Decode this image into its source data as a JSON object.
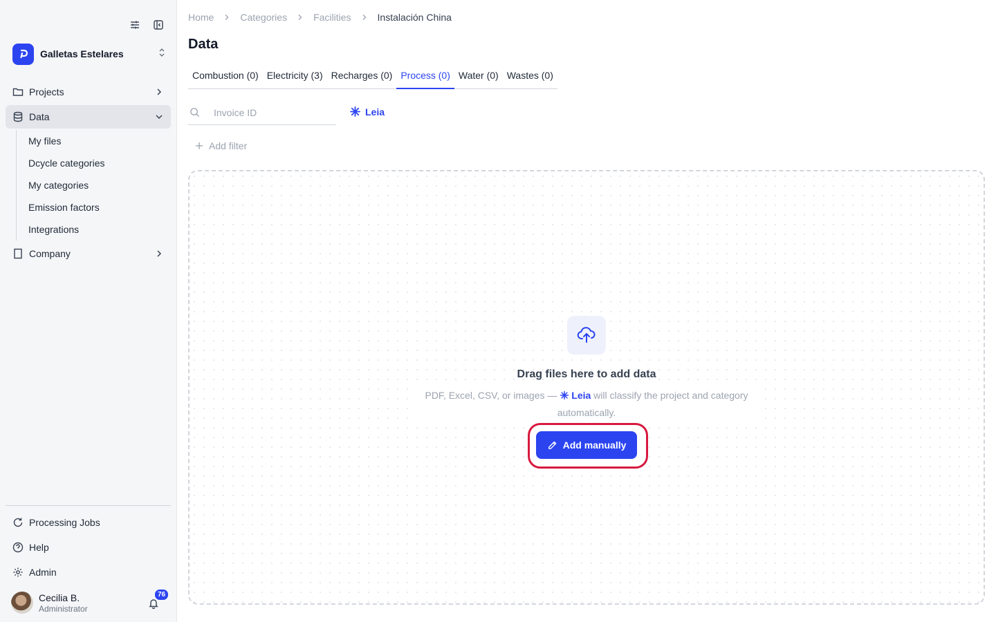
{
  "sidebar": {
    "org_name": "Galletas Estelares",
    "nav": [
      {
        "label": "Projects"
      },
      {
        "label": "Data"
      },
      {
        "label": "Company"
      }
    ],
    "data_subitems": [
      "My files",
      "Dcycle categories",
      "My categories",
      "Emission factors",
      "Integrations"
    ],
    "bottom": [
      {
        "label": "Processing Jobs"
      },
      {
        "label": "Help"
      },
      {
        "label": "Admin"
      }
    ],
    "user": {
      "name": "Cecilia B.",
      "role": "Administrator",
      "notifications": "76"
    }
  },
  "breadcrumb": [
    "Home",
    "Categories",
    "Facilities",
    "Instalación China"
  ],
  "page_title": "Data",
  "tabs": [
    {
      "label": "Combustion (0)"
    },
    {
      "label": "Electricity (3)"
    },
    {
      "label": "Recharges (0)"
    },
    {
      "label": "Process (0)",
      "active": true
    },
    {
      "label": "Water (0)"
    },
    {
      "label": "Wastes (0)"
    }
  ],
  "search": {
    "placeholder": "Invoice ID"
  },
  "leia_label": "Leia",
  "add_filter_label": "Add filter",
  "dropzone": {
    "title": "Drag files here to add data",
    "desc_before": "PDF, Excel, CSV, or images — ",
    "desc_leia": "Leia",
    "desc_after": " will classify the project and category automatically.",
    "button_label": "Add manually"
  },
  "colors": {
    "accent": "#2b44f0",
    "highlight": "#d7193f"
  }
}
